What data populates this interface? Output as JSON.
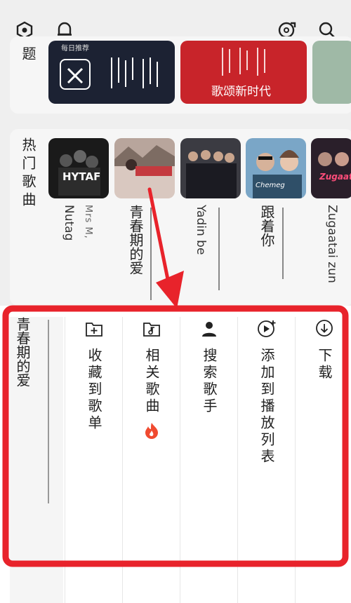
{
  "header": {
    "settings_icon": "settings-hex-icon",
    "bell_icon": "bell-icon",
    "disc_icon": "music-disc-icon",
    "search_icon": "search-icon"
  },
  "recommend": {
    "label": "题",
    "cards": [
      {
        "title": "每日推荐"
      },
      {
        "title": "歌颂新时代"
      }
    ]
  },
  "hot_songs": {
    "label": "热门歌曲",
    "songs": [
      {
        "title": "Nutag",
        "artist": "Mrs M,",
        "thumb_text": "HYTAF"
      },
      {
        "title": "青春期的爱",
        "artist": "",
        "thumb_text": ""
      },
      {
        "title": "Yadin be",
        "artist": "",
        "thumb_text": ""
      },
      {
        "title": "跟着你",
        "artist": "",
        "thumb_text": "Chemeg"
      },
      {
        "title": "Zugaatai zun",
        "artist": "",
        "thumb_text": "Zugaatai zun"
      }
    ]
  },
  "sheet": {
    "song_title": "青春期的爱",
    "options": [
      {
        "label": "收藏到歌单",
        "icon": "add-to-folder-icon"
      },
      {
        "label": "相关歌曲",
        "icon": "music-folder-icon",
        "badge": "hot-flame-icon"
      },
      {
        "label": "搜索歌手",
        "icon": "person-icon"
      },
      {
        "label": "添加到播放列表",
        "icon": "add-to-playlist-icon"
      },
      {
        "label": "下载",
        "icon": "download-icon"
      }
    ]
  },
  "annotation": {
    "highlight_color": "#e8232b"
  }
}
